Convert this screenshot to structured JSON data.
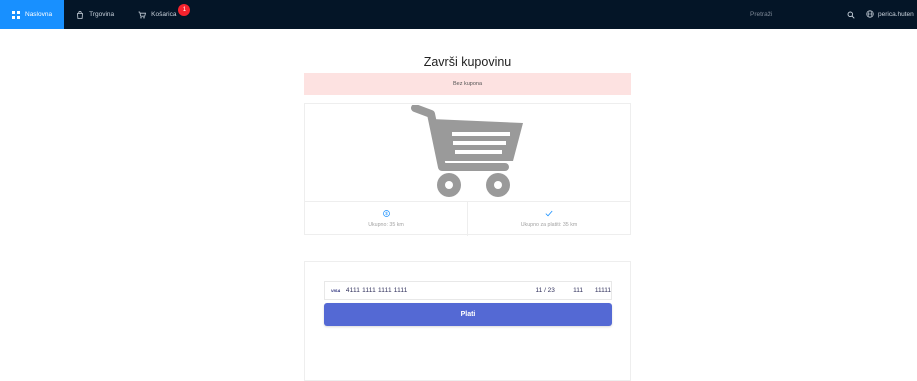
{
  "nav": {
    "home_label": "Naslovna",
    "shop_label": "Trgovina",
    "cart_label": "Košarica",
    "cart_badge": "1",
    "active": "home"
  },
  "search": {
    "placeholder": "Pretraži"
  },
  "user": {
    "name": "perica.huten"
  },
  "checkout": {
    "title": "Završi kupovinu",
    "coupon_text": "Bez kupona",
    "total_label": "Ukupno: 35 km",
    "to_pay_label": "Ukupno za platiti: 35 km"
  },
  "payment": {
    "card_brand": "VISA",
    "card_number": "4111 1111 1111 1111",
    "expiry": "11 / 23",
    "cvc": "111",
    "zip": "11111",
    "pay_button": "Plati"
  },
  "colors": {
    "topbar": "#041527",
    "active_nav": "#1890ff",
    "coupon_bg": "#fde2e1",
    "pay_button": "#5469d4",
    "stat_icon": "#1890ff",
    "cart_image": "#9a9a9a"
  },
  "icons": {
    "home": "appstore-icon",
    "shop": "shopping-icon",
    "cart": "shopping-cart-icon",
    "search": "search-icon",
    "user": "global-icon",
    "total": "dollar-circle-icon",
    "to_pay": "check-icon"
  }
}
